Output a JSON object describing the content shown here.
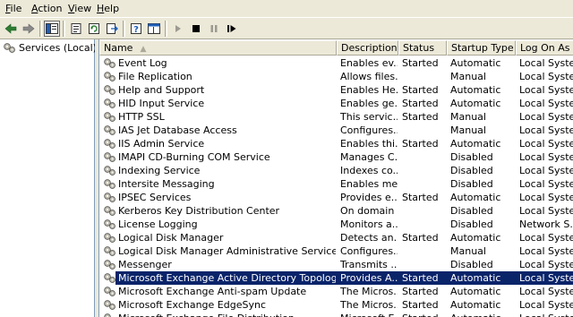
{
  "menu": [
    {
      "pre": "",
      "u": "F",
      "post": "ile"
    },
    {
      "pre": "",
      "u": "A",
      "post": "ction"
    },
    {
      "pre": "",
      "u": "V",
      "post": "iew"
    },
    {
      "pre": "",
      "u": "H",
      "post": "elp"
    }
  ],
  "tree": {
    "root_label": "Services (Local)"
  },
  "columns": {
    "name": "Name",
    "description": "Description",
    "status": "Status",
    "startup": "Startup Type",
    "logon": "Log On As"
  },
  "rows": [
    {
      "name": "Event Log",
      "description": "Enables ev...",
      "status": "Started",
      "startup": "Automatic",
      "logon": "Local System"
    },
    {
      "name": "File Replication",
      "description": "Allows files...",
      "status": "",
      "startup": "Manual",
      "logon": "Local System"
    },
    {
      "name": "Help and Support",
      "description": "Enables He...",
      "status": "Started",
      "startup": "Automatic",
      "logon": "Local System"
    },
    {
      "name": "HID Input Service",
      "description": "Enables ge...",
      "status": "Started",
      "startup": "Automatic",
      "logon": "Local System"
    },
    {
      "name": "HTTP SSL",
      "description": "This servic...",
      "status": "Started",
      "startup": "Manual",
      "logon": "Local System"
    },
    {
      "name": "IAS Jet Database Access",
      "description": "Configures...",
      "status": "",
      "startup": "Manual",
      "logon": "Local System"
    },
    {
      "name": "IIS Admin Service",
      "description": "Enables thi...",
      "status": "Started",
      "startup": "Automatic",
      "logon": "Local System"
    },
    {
      "name": "IMAPI CD-Burning COM Service",
      "description": "Manages C...",
      "status": "",
      "startup": "Disabled",
      "logon": "Local System"
    },
    {
      "name": "Indexing Service",
      "description": "Indexes co...",
      "status": "",
      "startup": "Disabled",
      "logon": "Local System"
    },
    {
      "name": "Intersite Messaging",
      "description": "Enables me...",
      "status": "",
      "startup": "Disabled",
      "logon": "Local System"
    },
    {
      "name": "IPSEC Services",
      "description": "Provides e...",
      "status": "Started",
      "startup": "Automatic",
      "logon": "Local System"
    },
    {
      "name": "Kerberos Key Distribution Center",
      "description": "On domain ...",
      "status": "",
      "startup": "Disabled",
      "logon": "Local System"
    },
    {
      "name": "License Logging",
      "description": "Monitors a...",
      "status": "",
      "startup": "Disabled",
      "logon": "Network S..."
    },
    {
      "name": "Logical Disk Manager",
      "description": "Detects an...",
      "status": "Started",
      "startup": "Automatic",
      "logon": "Local System"
    },
    {
      "name": "Logical Disk Manager Administrative Service",
      "description": "Configures...",
      "status": "",
      "startup": "Manual",
      "logon": "Local System"
    },
    {
      "name": "Messenger",
      "description": "Transmits ...",
      "status": "",
      "startup": "Disabled",
      "logon": "Local System"
    },
    {
      "name": "Microsoft Exchange Active Directory Topology Service",
      "description": "Provides A...",
      "status": "Started",
      "startup": "Automatic",
      "logon": "Local System",
      "selected": true
    },
    {
      "name": "Microsoft Exchange Anti-spam Update",
      "description": "The Micros...",
      "status": "Started",
      "startup": "Automatic",
      "logon": "Local System"
    },
    {
      "name": "Microsoft Exchange EdgeSync",
      "description": "The Micros...",
      "status": "Started",
      "startup": "Automatic",
      "logon": "Local System"
    },
    {
      "name": "Microsoft Exchange File Distribution",
      "description": "Microsoft E...",
      "status": "Started",
      "startup": "Automatic",
      "logon": "Local System"
    }
  ],
  "icons": {
    "back": "back-arrow-icon",
    "forward": "forward-arrow-icon",
    "tree": "show-hide-tree-icon",
    "properties": "properties-icon",
    "refresh": "refresh-icon",
    "export": "export-list-icon",
    "help": "help-icon",
    "console": "console-pane-icon",
    "start": "start-service-icon",
    "stop": "stop-service-icon",
    "pause": "pause-service-icon",
    "restart": "restart-service-icon",
    "service": "service-gear-icon"
  },
  "colors": {
    "selection": "#0a246a",
    "chrome": "#ece9d8"
  }
}
